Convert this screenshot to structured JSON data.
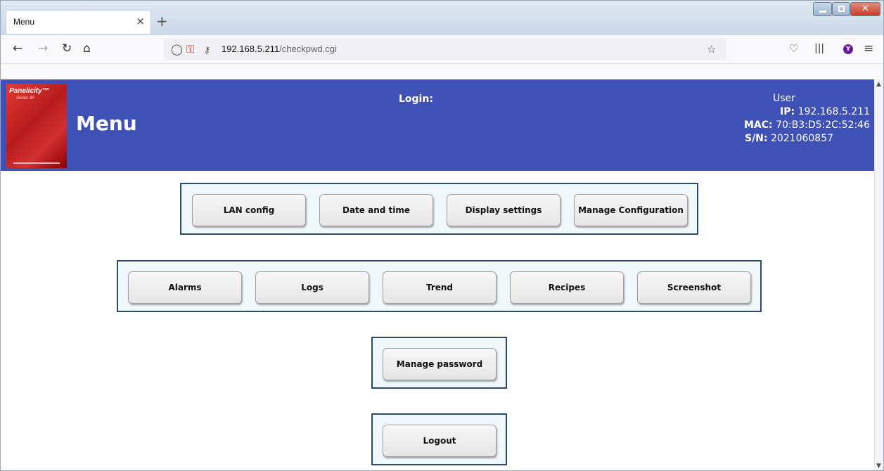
{
  "browser": {
    "tab_title": "Menu",
    "tab_close": "×",
    "new_tab": "+",
    "url_host": "192.168.5.211",
    "url_path": "/checkpwd.cgi",
    "avatar_letter": "Y"
  },
  "header": {
    "logo_brand": "Panelicity™",
    "logo_series": "Series 30",
    "title": "Menu",
    "login_label": "Login:",
    "user": "User",
    "ip_label": "IP:",
    "ip_value": "192.168.5.211",
    "mac_label": "MAC:",
    "mac_value": "70:B3:D5:2C:52:46",
    "sn_label": "S/N:",
    "sn_value": "2021060857",
    "bg_color": "#3f51b5"
  },
  "groups": {
    "config": [
      "LAN config",
      "Date and time",
      "Display settings",
      "Manage Configuration"
    ],
    "data": [
      "Alarms",
      "Logs",
      "Trend",
      "Recipes",
      "Screenshot"
    ],
    "password": "Manage password",
    "logout": "Logout"
  }
}
